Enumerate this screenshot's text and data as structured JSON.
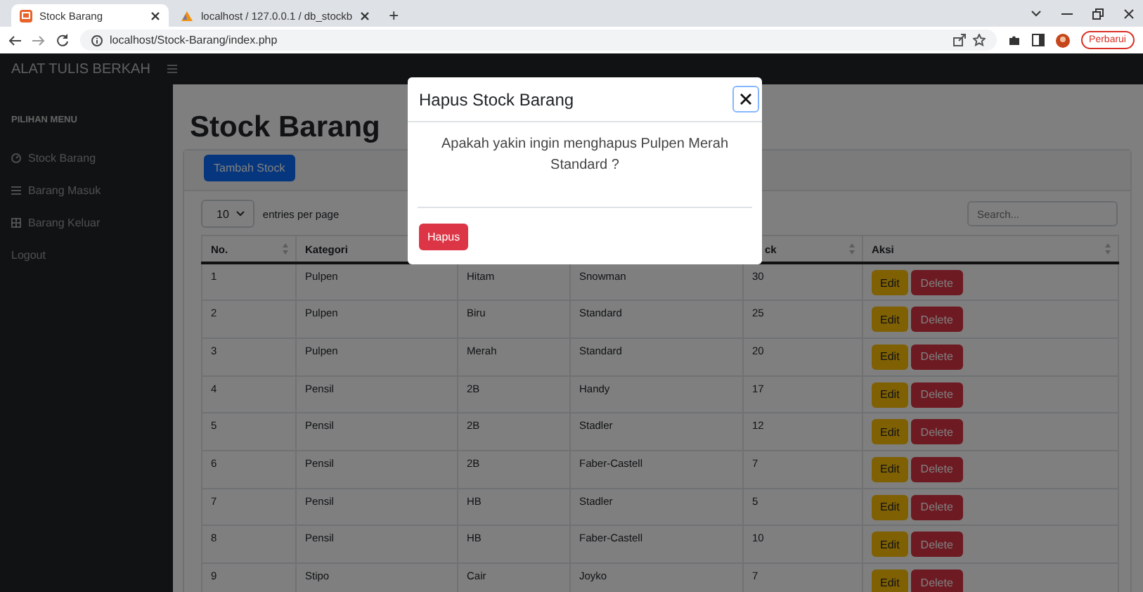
{
  "browser": {
    "tabs": [
      {
        "title": "Stock Barang",
        "selected": true
      },
      {
        "title": "localhost / 127.0.0.1 / db_stockb",
        "selected": false
      }
    ],
    "new_tab": "+",
    "url": "localhost/Stock-Barang/index.php",
    "update_button": "Perbarui"
  },
  "navbar": {
    "brand": "ALAT TULIS BERKAH"
  },
  "sidebar": {
    "heading": "PILIHAN MENU",
    "items": [
      {
        "label": "Stock Barang",
        "kind": "gauge"
      },
      {
        "label": "Barang Masuk",
        "kind": "list"
      },
      {
        "label": "Barang Keluar",
        "kind": "table"
      },
      {
        "label": "Logout",
        "kind": "plain"
      }
    ]
  },
  "page": {
    "title": "Stock Barang",
    "add_button": "Tambah Stock",
    "page_size": "10",
    "page_size_label": "entries per page",
    "search": {
      "placeholder": "Search..."
    }
  },
  "table": {
    "columns": [
      {
        "label": "No."
      },
      {
        "label": "Kategori"
      },
      {},
      {},
      {
        "label": "ck"
      },
      {
        "label": "Aksi"
      }
    ],
    "rows": [
      {
        "cells": [
          "1",
          "Pulpen",
          "Hitam",
          "Snowman",
          "30"
        ],
        "actions": [
          "Edit",
          "Delete"
        ]
      },
      {
        "cells": [
          "2",
          "Pulpen",
          "Biru",
          "Standard",
          "25"
        ],
        "actions": [
          "Edit",
          "Delete"
        ]
      },
      {
        "cells": [
          "3",
          "Pulpen",
          "Merah",
          "Standard",
          "20"
        ],
        "actions": [
          "Edit",
          "Delete"
        ]
      },
      {
        "cells": [
          "4",
          "Pensil",
          "2B",
          "Handy",
          "17"
        ],
        "actions": [
          "Edit",
          "Delete"
        ]
      },
      {
        "cells": [
          "5",
          "Pensil",
          "2B",
          "Stadler",
          "12"
        ],
        "actions": [
          "Edit",
          "Delete"
        ]
      },
      {
        "cells": [
          "6",
          "Pensil",
          "2B",
          "Faber-Castell",
          "7"
        ],
        "actions": [
          "Edit",
          "Delete"
        ]
      },
      {
        "cells": [
          "7",
          "Pensil",
          "HB",
          "Stadler",
          "5"
        ],
        "actions": [
          "Edit",
          "Delete"
        ]
      },
      {
        "cells": [
          "8",
          "Pensil",
          "HB",
          "Faber-Castell",
          "10"
        ],
        "actions": [
          "Edit",
          "Delete"
        ]
      },
      {
        "cells": [
          "9",
          "Stipo",
          "Cair",
          "Joyko",
          "7"
        ],
        "actions": [
          "Edit",
          "Delete"
        ]
      }
    ]
  },
  "modal": {
    "title": "Hapus Stock Barang",
    "message": "Apakah yakin ingin menghapus Pulpen Merah Standard ?",
    "confirm_button": "Hapus"
  }
}
